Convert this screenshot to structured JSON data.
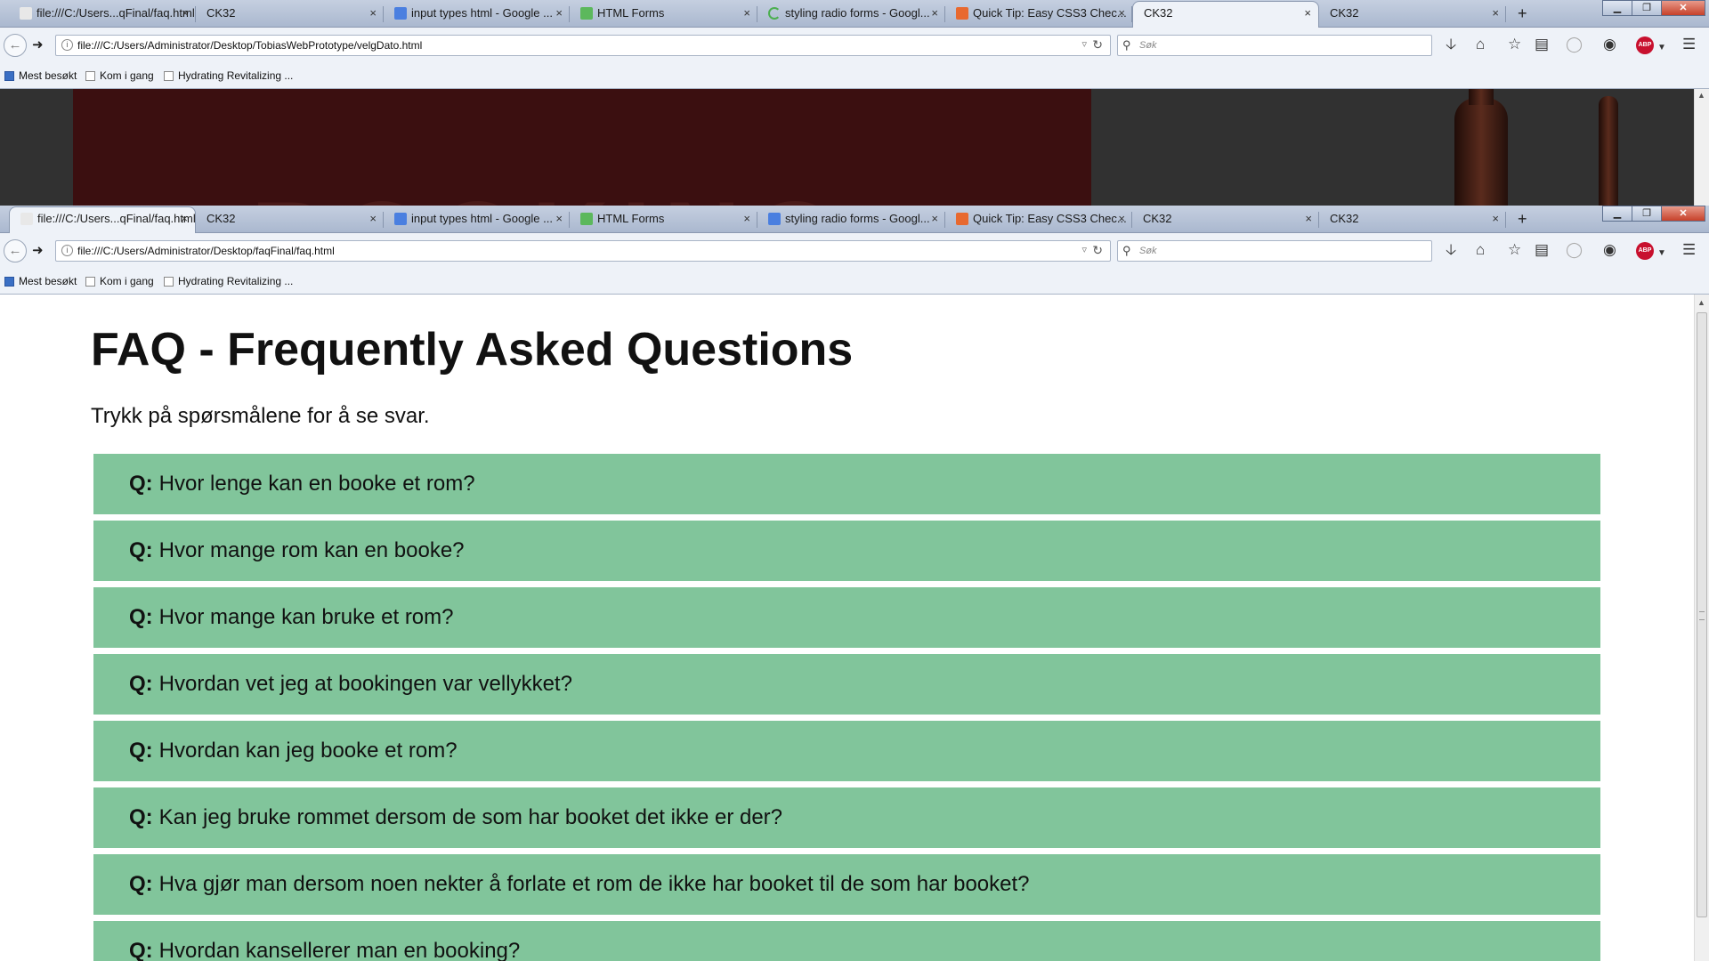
{
  "browser": {
    "new_tab_glyph": "+",
    "window_controls": {
      "minimize": "▁",
      "maximize": "❐",
      "close": "✕"
    },
    "bookmarks": [
      "Mest besøkt",
      "Kom i gang",
      "Hydrating Revitalizing ..."
    ]
  },
  "back_window": {
    "tabs": [
      {
        "label": "file:///C:/Users...qFinal/faq.html",
        "icon": "page-icon"
      },
      {
        "label": "CK32",
        "icon": "none"
      },
      {
        "label": "input types html - Google ...",
        "icon": "google-icon"
      },
      {
        "label": "HTML Forms",
        "icon": "w3-icon"
      },
      {
        "label": "styling radio forms - Googl...",
        "icon": "loading-spinner-icon"
      },
      {
        "label": "Quick Tip: Easy CSS3 Chec...",
        "icon": "site-icon"
      },
      {
        "label": "CK32",
        "icon": "none",
        "active": true
      },
      {
        "label": "CK32",
        "icon": "none"
      }
    ],
    "url": "file:///C:/Users/Administrator/Desktop/TobiasWebPrototype/velgDato.html",
    "search_placeholder": "Søk"
  },
  "front_window": {
    "tabs": [
      {
        "label": "file:///C:/Users...qFinal/faq.html",
        "icon": "page-icon",
        "active": true
      },
      {
        "label": "CK32",
        "icon": "none"
      },
      {
        "label": "input types html - Google ...",
        "icon": "google-icon"
      },
      {
        "label": "HTML Forms",
        "icon": "w3-icon"
      },
      {
        "label": "styling radio forms - Googl...",
        "icon": "google-icon"
      },
      {
        "label": "Quick Tip: Easy CSS3 Chec...",
        "icon": "site-icon"
      },
      {
        "label": "CK32",
        "icon": "none"
      },
      {
        "label": "CK32",
        "icon": "none"
      }
    ],
    "url": "file:///C:/Users/Administrator/Desktop/faqFinal/faq.html",
    "search_placeholder": "Søk"
  },
  "page": {
    "title": "FAQ - Frequently Asked Questions",
    "intro": "Trykk på spørsmålene for å se svar.",
    "question_prefix": "Q:",
    "questions": [
      "Hvor lenge kan en booke et rom?",
      "Hvor mange rom kan en booke?",
      "Hvor mange kan bruke et rom?",
      "Hvordan vet jeg at bookingen var vellykket?",
      "Hvordan kan jeg booke et rom?",
      "Kan jeg bruke rommet dersom de som har booket det ikke er der?",
      "Hva gjør man dersom noen nekter å forlate et rom de ikke har booket til de som har booket?",
      "Hvordan kansellerer man en booking?"
    ]
  },
  "colors": {
    "faq_item_bg": "#81c59b",
    "chrome_bg": "#eef2f8",
    "back_banner": "#3b0f10",
    "back_page_bg": "#313131"
  }
}
